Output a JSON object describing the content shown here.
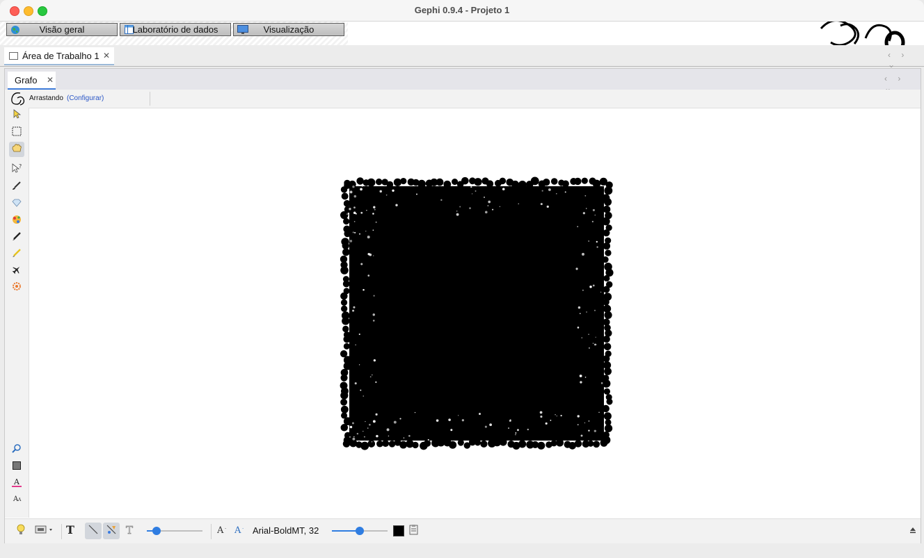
{
  "window": {
    "title": "Gephi 0.9.4 - Projeto 1"
  },
  "nav_tabs": [
    {
      "label": "Visão geral",
      "icon": "globe-icon"
    },
    {
      "label": "Laboratório de dados",
      "icon": "table-icon"
    },
    {
      "label": "Visualização",
      "icon": "monitor-icon"
    }
  ],
  "workspace": {
    "tab_label": "Área de Trabalho 1",
    "close_glyph": "✕"
  },
  "graph_panel": {
    "tab_label": "Grafo",
    "close_glyph": "✕",
    "mode_label": "Arrastando",
    "configure_link": "(Configurar)"
  },
  "toolbar": {
    "font_label": "Arial-BoldMT, 32",
    "edge_size_slider": 0.18,
    "label_size_slider": 0.5,
    "label_color": "#000000"
  },
  "left_tools": [
    "select-pointer-icon",
    "rectangle-select-icon",
    "drag-hand-icon",
    "edit-node-icon",
    "brush-icon",
    "diamond-icon",
    "paint-bucket-icon",
    "pencil-icon",
    "edge-pencil-icon",
    "airplane-icon",
    "heat-gear-icon"
  ],
  "colors": {
    "graph_fill": "#000000",
    "accent": "#2f7de1",
    "link": "#2a56c6"
  }
}
